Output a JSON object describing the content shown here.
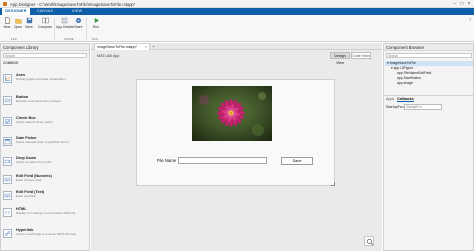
{
  "window": {
    "title": "App Designer - C:\\Work\\ImageSaveToFile\\ImageSaveToFile.mlapp*"
  },
  "ribbon_tabs": [
    {
      "label": "DESIGNER",
      "active": true
    },
    {
      "label": "CANVAS",
      "active": false
    },
    {
      "label": "VIEW",
      "active": false
    }
  ],
  "toolstrip": {
    "tools": [
      {
        "label": "New",
        "icon": "new-file-icon"
      },
      {
        "label": "Open",
        "icon": "open-folder-icon"
      },
      {
        "label": "Save",
        "icon": "save-icon"
      },
      {
        "label": "Compare",
        "icon": "compare-icon"
      },
      {
        "label": "App Details",
        "icon": "app-details-icon"
      },
      {
        "label": "Share",
        "icon": "share-icon"
      },
      {
        "label": "Run",
        "icon": "run-icon"
      }
    ],
    "groups": [
      "FILE",
      "SHARE",
      "RUN"
    ]
  },
  "component_library": {
    "title": "Component Library",
    "search_placeholder": "Search",
    "section": "COMMON",
    "items": [
      {
        "name": "Axes",
        "desc": "Display graphs and data visualization"
      },
      {
        "name": "Button",
        "desc": "Execute command when pressed"
      },
      {
        "name": "Check Box",
        "desc": "Select state of binary option"
      },
      {
        "name": "Date Picker",
        "desc": "Select calendar date in specified format"
      },
      {
        "name": "Drop Down",
        "desc": "Select an option from a list"
      },
      {
        "name": "Edit Field (Numeric)",
        "desc": "Enter numeric data"
      },
      {
        "name": "Edit Field (Text)",
        "desc": "Enter text data"
      },
      {
        "name": "HTML",
        "desc": "Display rich markup or incorporate HTML file"
      },
      {
        "name": "Hyperlink",
        "desc": "Link to a web page or execute MATLAB code"
      }
    ]
  },
  "document": {
    "tab_label": "ImageSaveToFile.mlapp*",
    "app_title": "MATLAB App",
    "views": [
      "Design View",
      "Code View"
    ],
    "file_name_label": "File Name",
    "file_name_value": "",
    "save_label": "Save"
  },
  "component_browser": {
    "title": "Component Browser",
    "search_placeholder": "Search",
    "tree": [
      {
        "label": "ImageSaveToFile",
        "level": 0,
        "selected": true
      },
      {
        "label": "app.UIFigure",
        "level": 1,
        "selected": false
      },
      {
        "label": "app.FileNameEditField",
        "level": 2,
        "selected": false
      },
      {
        "label": "app.SaveButton",
        "level": 2,
        "selected": false
      },
      {
        "label": "app.Image",
        "level": 2,
        "selected": false
      }
    ],
    "inspector_tabs": [
      "Apps",
      "Callbacks"
    ],
    "inspector_active": "Callbacks",
    "property_label": "StartupFcn",
    "property_value": "StartupFcn"
  },
  "colors": {
    "ribbon": "#0f5ea8",
    "selection": "#cfe3f7"
  }
}
